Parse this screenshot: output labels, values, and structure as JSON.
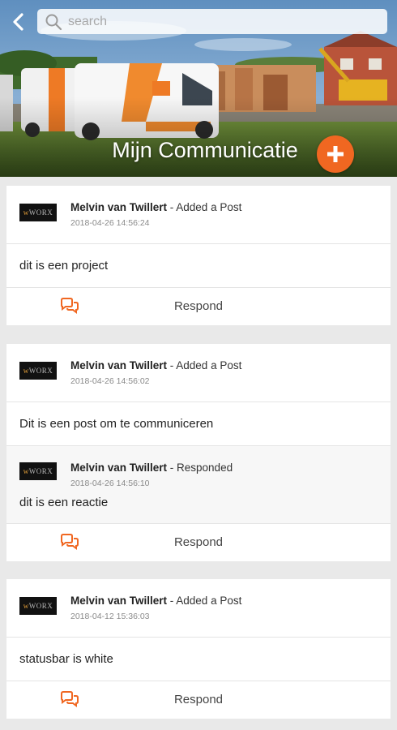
{
  "header": {
    "back_icon": "chevron-left-icon",
    "search": {
      "placeholder": "search",
      "value": "",
      "icon": "search-icon"
    },
    "title": "Mijn Communicatie",
    "add_icon": "plus-icon",
    "accent": "#f06721"
  },
  "posts": [
    {
      "author": "Melvin van Twillert",
      "action": " - Added a Post",
      "timestamp": "2018-04-26 14:56:24",
      "text": "dit is een project",
      "replies": [],
      "respond_label": "Respond"
    },
    {
      "author": "Melvin van Twillert",
      "action": " - Added a Post",
      "timestamp": "2018-04-26 14:56:02",
      "text": "Dit is een post om te communiceren",
      "replies": [
        {
          "author": "Melvin van Twillert",
          "action": " - Responded",
          "timestamp": "2018-04-26 14:56:10",
          "text": "dit is een reactie"
        }
      ],
      "respond_label": "Respond"
    },
    {
      "author": "Melvin van Twillert",
      "action": " - Added a Post",
      "timestamp": "2018-04-12 15:36:03",
      "text": "statusbar is white",
      "replies": [],
      "respond_label": "Respond"
    }
  ],
  "logo_text": {
    "mark": "w",
    "word": "WORX"
  },
  "respond_icon": "chat-bubbles-icon"
}
